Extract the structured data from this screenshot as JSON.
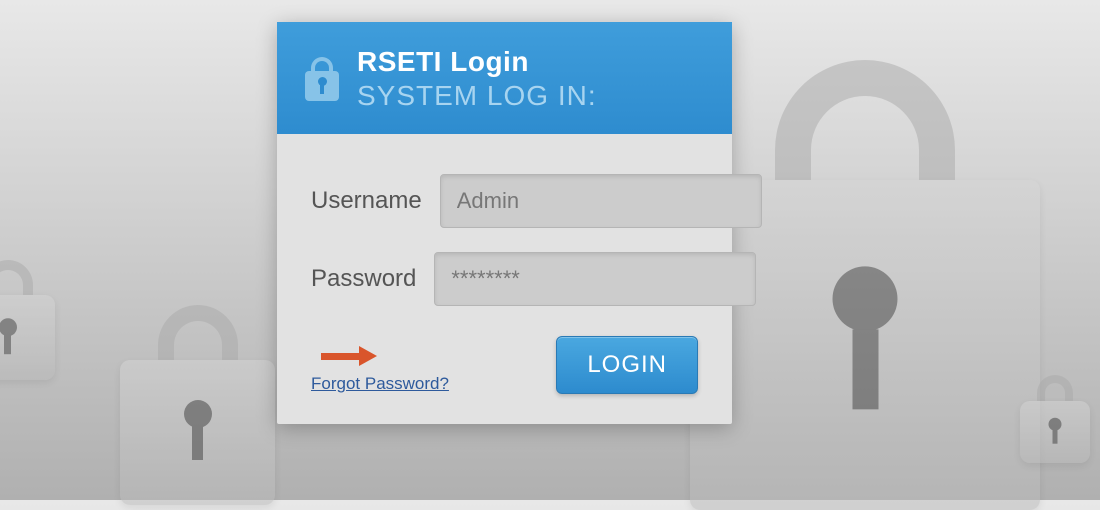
{
  "header": {
    "title": "RSETI Login",
    "subtitle": "SYSTEM LOG IN:"
  },
  "form": {
    "username_label": "Username",
    "username_value": "Admin",
    "password_label": "Password",
    "password_value": "********"
  },
  "actions": {
    "forgot_label": "Forgot Password?",
    "login_label": "LOGIN"
  }
}
